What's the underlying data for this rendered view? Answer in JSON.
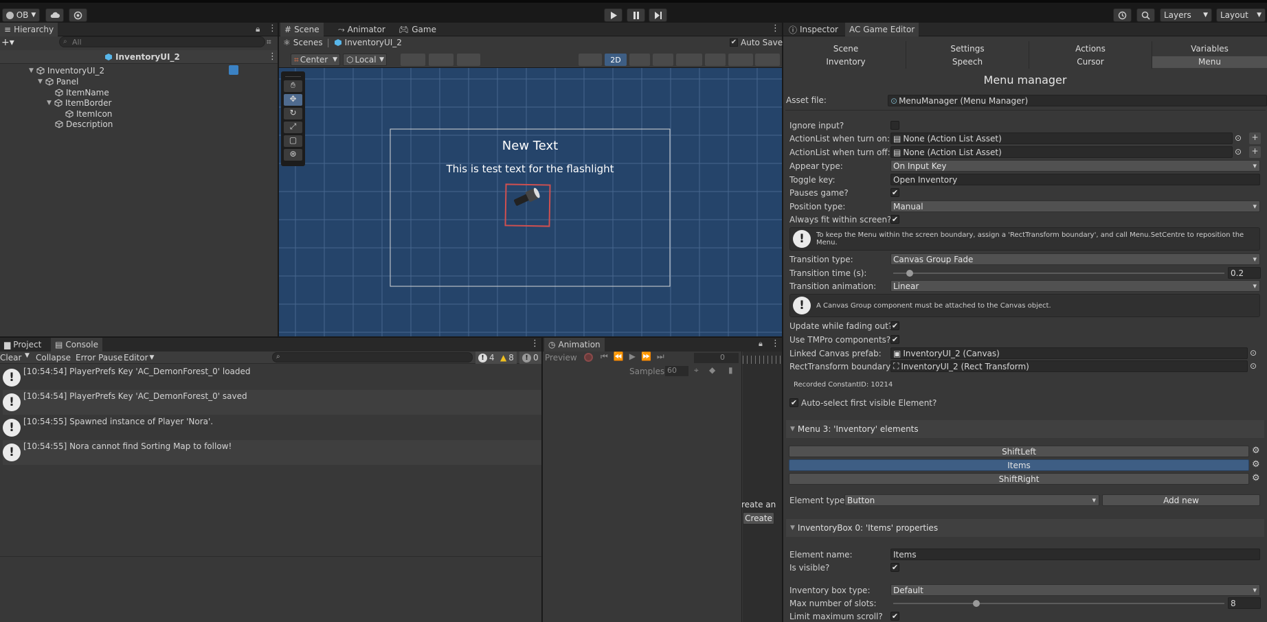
{
  "toolbar": {
    "account": "OB",
    "layers": "Layers",
    "layout": "Layout"
  },
  "hierarchy": {
    "tab": "Hierarchy",
    "search_placeholder": "All",
    "scene": "InventoryUI_2",
    "items": [
      "InventoryUI_2",
      "Panel",
      "ItemName",
      "ItemBorder",
      "ItemIcon",
      "Description"
    ]
  },
  "scene": {
    "tabs": [
      "Scene",
      "Animator",
      "Game"
    ],
    "auto_save": "Auto Save",
    "breadcrumb_root": "Scenes",
    "breadcrumb_item": "InventoryUI_2",
    "pivot": "Center",
    "space": "Local",
    "mode_2d": "2D",
    "canvas_title": "New Text",
    "canvas_subtitle": "This is test text for the flashlight"
  },
  "console": {
    "tabs": [
      "Project",
      "Console"
    ],
    "clear": "Clear",
    "collapse": "Collapse",
    "error_pause": "Error Pause",
    "editor": "Editor",
    "count_info": "4",
    "count_warn": "8",
    "count_err": "0",
    "logs": [
      "[10:54:54] PlayerPrefs Key 'AC_DemonForest_0' loaded",
      "[10:54:54] PlayerPrefs Key 'AC_DemonForest_0' saved",
      "[10:54:55] Spawned instance of Player 'Nora'.",
      "[10:54:55] Nora cannot find Sorting Map to follow!"
    ]
  },
  "animation": {
    "tab": "Animation",
    "preview": "Preview",
    "frame": "0",
    "samples_label": "Samples",
    "samples": "60",
    "create_text": "reate an",
    "create_btn": "Create"
  },
  "inspector": {
    "tabs": [
      "Inspector",
      "AC Game Editor"
    ],
    "categories_row1": [
      "Scene",
      "Settings",
      "Actions",
      "Variables"
    ],
    "categories_row2": [
      "Inventory",
      "Speech",
      "Cursor",
      "Menu"
    ],
    "title": "Menu manager",
    "asset_label": "Asset file:",
    "asset_value": "MenuManager (Menu Manager)",
    "labels": {
      "ignore_input": "Ignore input?",
      "al_on": "ActionList when turn on:",
      "al_off": "ActionList when turn off:",
      "appear_type": "Appear type:",
      "toggle_key": "Toggle key:",
      "pauses": "Pauses game?",
      "position_type": "Position type:",
      "fit_screen": "Always fit within screen?",
      "transition_type": "Transition type:",
      "transition_time": "Transition time (s):",
      "transition_anim": "Transition animation:",
      "update_fading": "Update while fading out?",
      "use_tmpro": "Use TMPro components?",
      "linked_canvas": "Linked Canvas prefab:",
      "rect_boundary": "RectTransform boundary:",
      "auto_select": "Auto-select first visible Element?",
      "element_type": "Element type:",
      "element_name": "Element name:",
      "is_visible": "Is visible?",
      "inv_box_type": "Inventory box type:",
      "max_slots": "Max number of slots:",
      "limit_scroll": "Limit maximum scroll?"
    },
    "values": {
      "al_on": "None (Action List Asset)",
      "al_off": "None (Action List Asset)",
      "appear_type": "On Input Key",
      "toggle_key": "Open Inventory",
      "position_type": "Manual",
      "transition_type": "Canvas Group Fade",
      "transition_time": "0.2",
      "transition_anim": "Linear",
      "linked_canvas": "InventoryUI_2 (Canvas)",
      "rect_boundary": "InventoryUI_2 (Rect Transform)",
      "element_type": "Button",
      "element_name": "Items",
      "inv_box_type": "Default",
      "max_slots": "8"
    },
    "help_fit": "To keep the Menu within the screen boundary, assign a 'RectTransform boundary', and call Menu.SetCentre to reposition the Menu.",
    "help_canvas": "A Canvas Group component must be attached to the Canvas object.",
    "constant_id": "Recorded ConstantID: 10214",
    "section_elements": "Menu 3: 'Inventory' elements",
    "elements": [
      "ShiftLeft",
      "Items",
      "ShiftRight"
    ],
    "add_new": "Add new",
    "section_props": "InventoryBox 0: 'Items' properties",
    "transition_time_fraction": 0.05,
    "max_slots_fraction": 0.25,
    "colors": {
      "selected_element": "#3e5e84",
      "panel": "#383838"
    }
  }
}
